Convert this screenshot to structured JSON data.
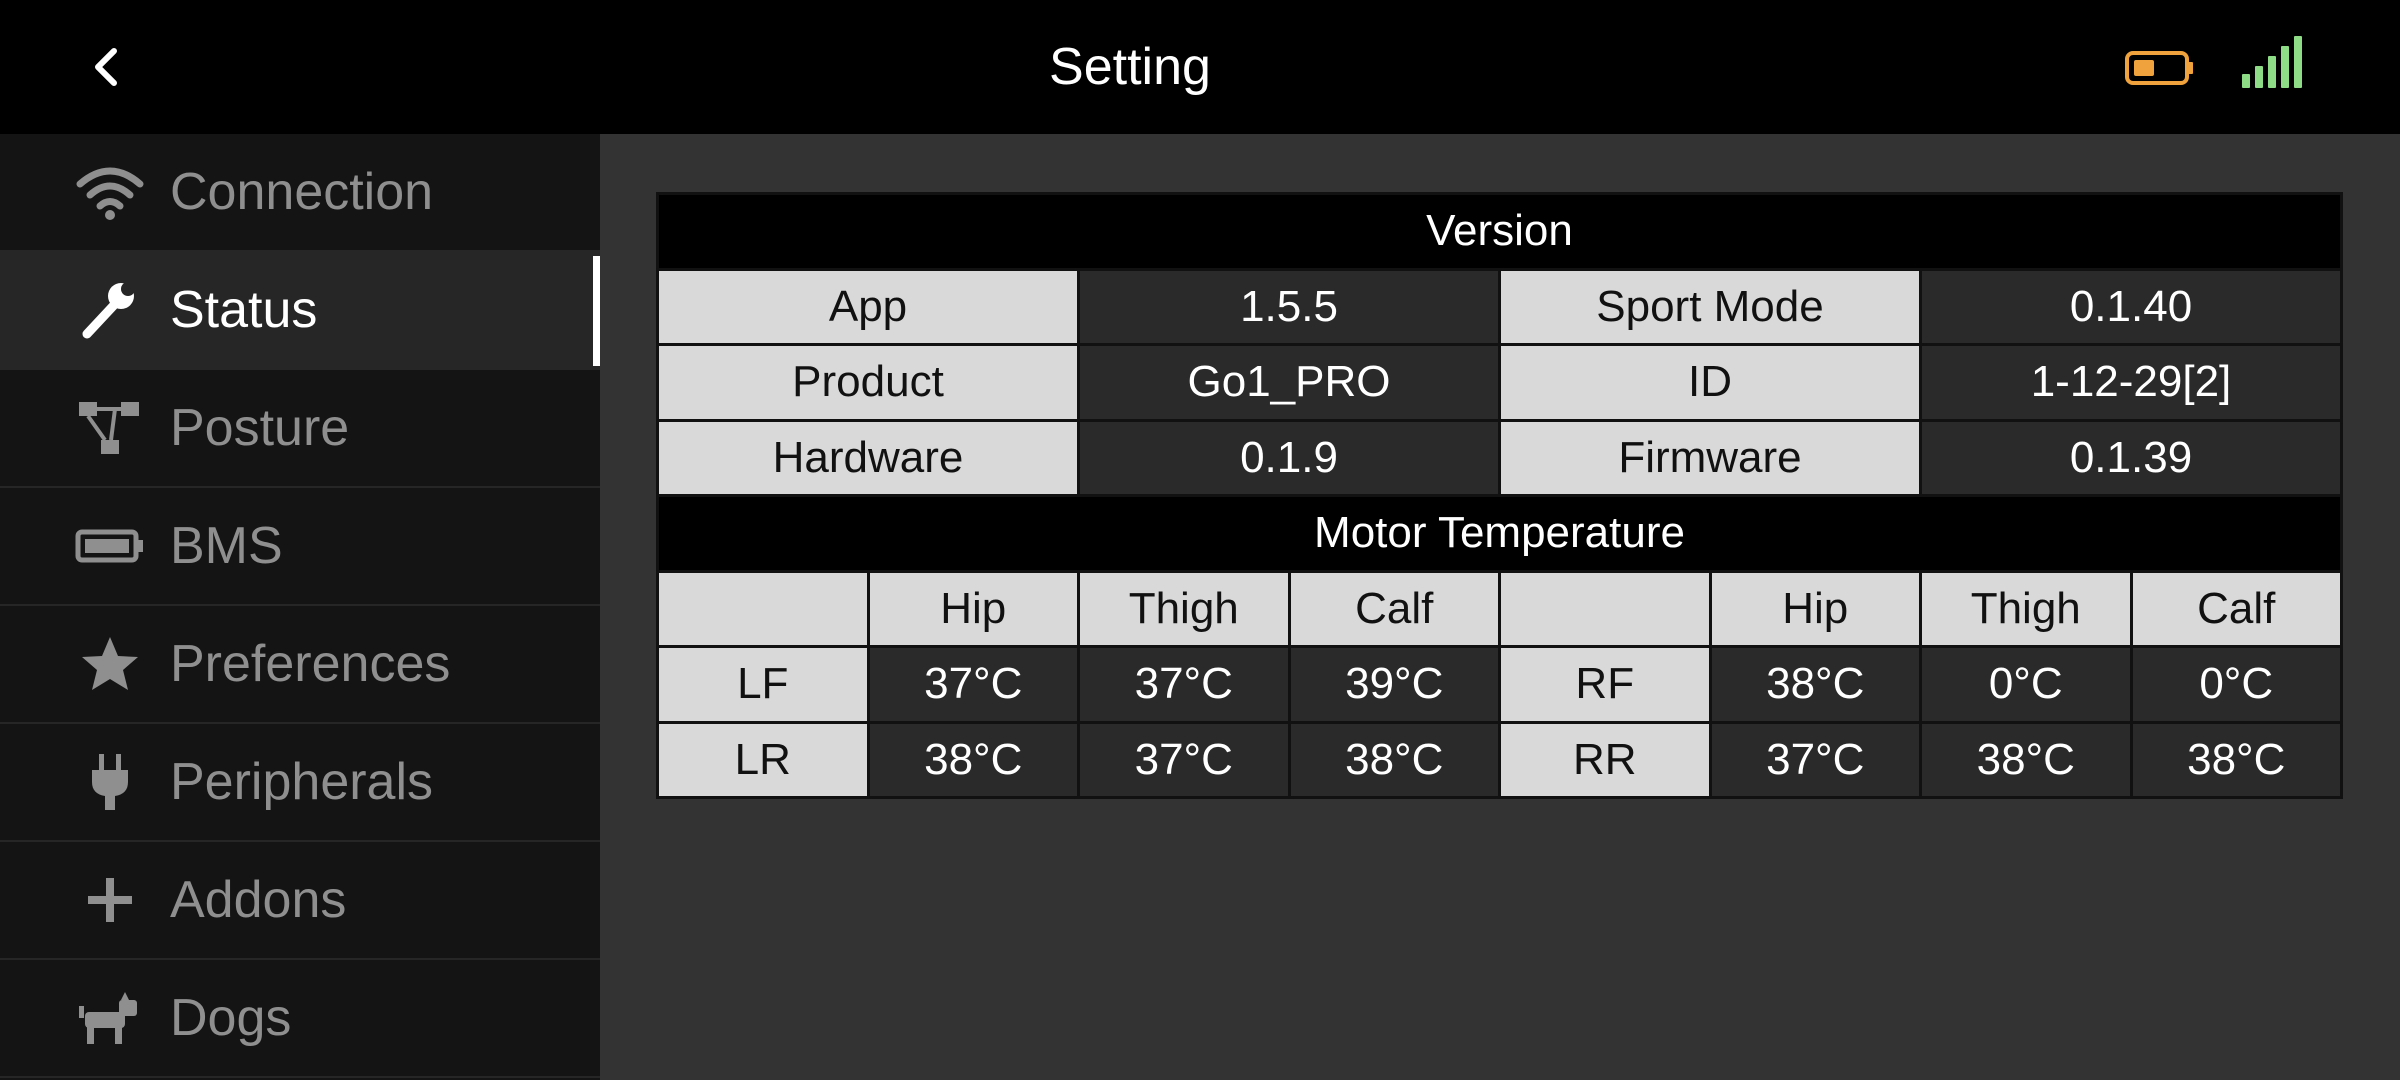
{
  "header": {
    "title": "Setting",
    "battery_color": "#f0a23c",
    "signal_color": "#8fdc86"
  },
  "sidebar": {
    "items": [
      {
        "label": "Connection",
        "icon": "wifi-icon"
      },
      {
        "label": "Status",
        "icon": "wrench-icon",
        "active": true
      },
      {
        "label": "Posture",
        "icon": "posture-icon"
      },
      {
        "label": "BMS",
        "icon": "battery-icon"
      },
      {
        "label": "Preferences",
        "icon": "star-icon"
      },
      {
        "label": "Peripherals",
        "icon": "plug-icon"
      },
      {
        "label": "Addons",
        "icon": "plus-icon"
      },
      {
        "label": "Dogs",
        "icon": "dog-icon"
      }
    ]
  },
  "version": {
    "title": "Version",
    "rows": [
      {
        "k1": "App",
        "v1": "1.5.5",
        "k2": "Sport Mode",
        "v2": "0.1.40"
      },
      {
        "k1": "Product",
        "v1": "Go1_PRO",
        "k2": "ID",
        "v2": "1-12-29[2]"
      },
      {
        "k1": "Hardware",
        "v1": "0.1.9",
        "k2": "Firmware",
        "v2": "0.1.39"
      }
    ]
  },
  "motor": {
    "title": "Motor Temperature",
    "headers": [
      "Hip",
      "Thigh",
      "Calf"
    ],
    "rows": [
      {
        "l": "LF",
        "lv": [
          "37°C",
          "37°C",
          "39°C"
        ],
        "r": "RF",
        "rv": [
          "38°C",
          "0°C",
          "0°C"
        ]
      },
      {
        "l": "LR",
        "lv": [
          "38°C",
          "37°C",
          "38°C"
        ],
        "r": "RR",
        "rv": [
          "37°C",
          "38°C",
          "38°C"
        ]
      }
    ]
  }
}
